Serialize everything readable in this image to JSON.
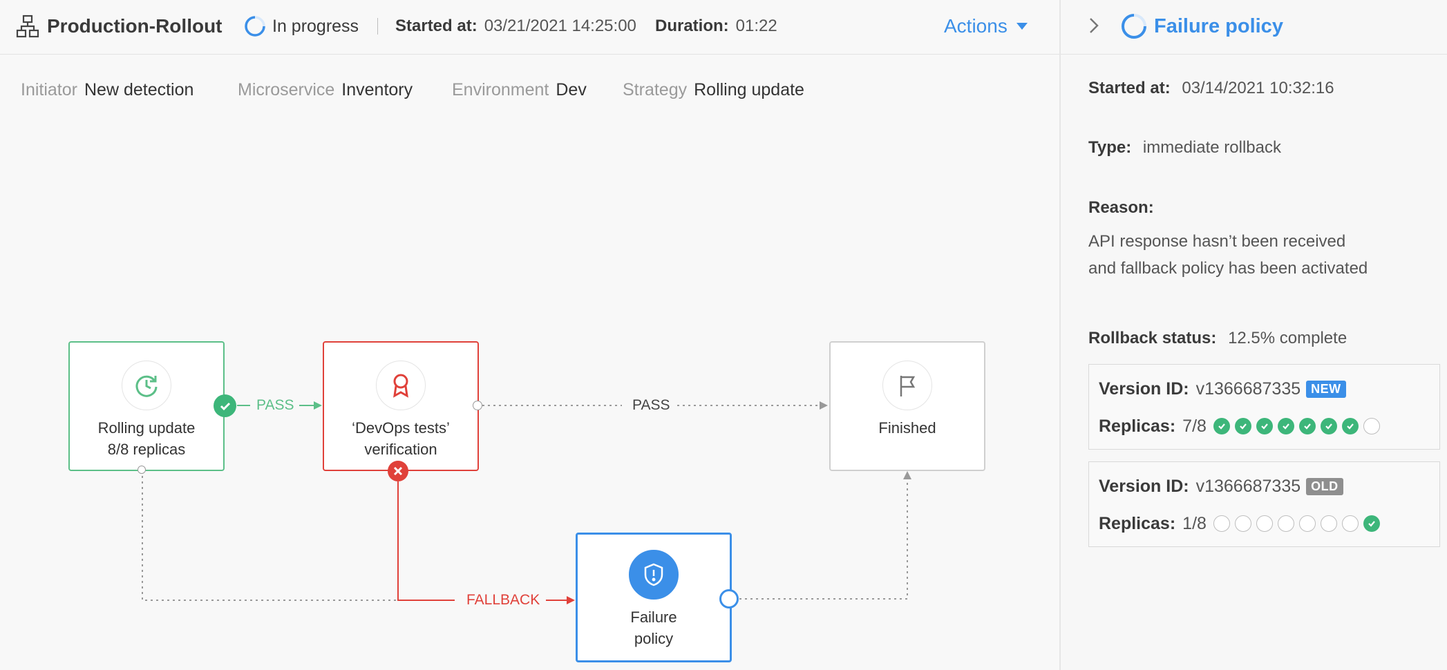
{
  "header": {
    "title": "Production-Rollout",
    "status": "In progress",
    "started_label": "Started at:",
    "started_value": "03/21/2021 14:25:00",
    "duration_label": "Duration:",
    "duration_value": "01:22",
    "actions_label": "Actions"
  },
  "meta": {
    "initiator_label": "Initiator",
    "initiator_value": "New detection",
    "microservice_label": "Microservice",
    "microservice_value": "Inventory",
    "environment_label": "Environment",
    "environment_value": "Dev",
    "strategy_label": "Strategy",
    "strategy_value": "Rolling update"
  },
  "flow": {
    "nodes": {
      "rolling": {
        "line1": "Rolling update",
        "line2": "8/8 replicas",
        "icon": "refresh-clock-icon",
        "color": "#5cbf88"
      },
      "devops": {
        "line1": "‘DevOps tests’",
        "line2": "verification",
        "icon": "award-ribbon-icon",
        "color": "#e0413a"
      },
      "finished": {
        "line1": "Finished",
        "icon": "flag-icon",
        "color": "#cfcfcf"
      },
      "failure": {
        "line1": "Failure",
        "line2": "policy",
        "icon": "shield-alert-icon",
        "color": "#3b8fe8"
      }
    },
    "edges": {
      "pass1": "PASS",
      "pass2": "PASS",
      "fallback": "FALLBACK"
    }
  },
  "panel": {
    "title": "Failure policy",
    "started_label": "Started at:",
    "started_value": "03/14/2021 10:32:16",
    "type_label": "Type:",
    "type_value": "immediate rollback",
    "reason_label": "Reason:",
    "reason_line1": "API response hasn’t been received",
    "reason_line2": "and fallback policy has been activated",
    "rollback_label": "Rollback status:",
    "rollback_value": "12.5% complete",
    "versions": [
      {
        "id_label": "Version ID:",
        "id": "v1366687335",
        "badge": "NEW",
        "badge_color": "#3b8fe8",
        "replicas_label": "Replicas:",
        "replicas": "7/8",
        "states": [
          1,
          1,
          1,
          1,
          1,
          1,
          1,
          0
        ]
      },
      {
        "id_label": "Version ID:",
        "id": "v1366687335",
        "badge": "OLD",
        "badge_color": "#8f8f8f",
        "replicas_label": "Replicas:",
        "replicas": "1/8",
        "states": [
          0,
          0,
          0,
          0,
          0,
          0,
          0,
          1
        ]
      }
    ]
  },
  "colors": {
    "accent": "#3b8fe8",
    "success": "#3db67a",
    "danger": "#e0413a",
    "muted": "#9a9a9a"
  }
}
